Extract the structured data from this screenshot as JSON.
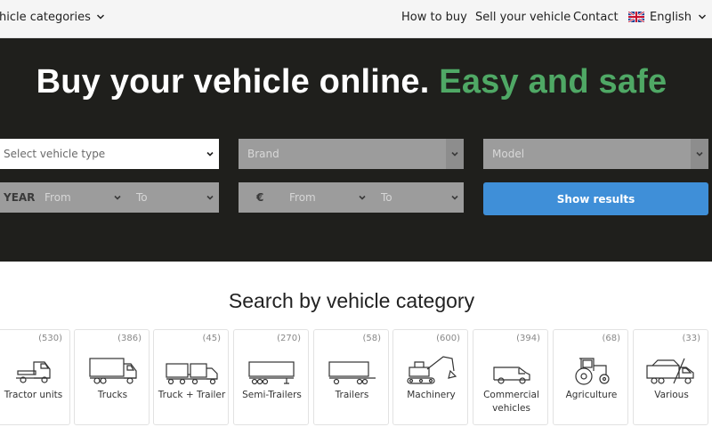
{
  "nav": {
    "categories_label": "ehicle categories",
    "links": [
      "How to buy",
      "Sell your vehicle",
      "Contact"
    ],
    "language": "English"
  },
  "hero": {
    "title_main": "Buy your vehicle online.",
    "title_accent": "Easy and safe"
  },
  "search": {
    "vehicle_type_placeholder": "Select vehicle type",
    "brand_placeholder": "Brand",
    "model_placeholder": "Model",
    "year_label": "YEAR",
    "year_from": "From",
    "year_to": "To",
    "price_label": "€",
    "price_from": "From",
    "price_to": "To",
    "submit_label": "Show results"
  },
  "categories": {
    "title": "Search by vehicle category",
    "items": [
      {
        "label": "Tractor units",
        "count": "(530)",
        "icon": "tractor-unit-icon"
      },
      {
        "label": "Trucks",
        "count": "(386)",
        "icon": "truck-icon"
      },
      {
        "label": "Truck + Trailer",
        "count": "(45)",
        "icon": "truck-trailer-icon"
      },
      {
        "label": "Semi-Trailers",
        "count": "(270)",
        "icon": "semi-trailer-icon"
      },
      {
        "label": "Trailers",
        "count": "(58)",
        "icon": "trailer-icon"
      },
      {
        "label": "Machinery",
        "count": "(600)",
        "icon": "excavator-icon"
      },
      {
        "label": "Commercial vehicles",
        "count": "(394)",
        "icon": "van-icon"
      },
      {
        "label": "Agriculture",
        "count": "(68)",
        "icon": "farm-tractor-icon"
      },
      {
        "label": "Various",
        "count": "(33)",
        "icon": "dump-truck-icon"
      }
    ]
  },
  "colors": {
    "hero_bg": "#1f1f1c",
    "accent_green": "#4fa865",
    "button_blue": "#3f8fd8"
  }
}
